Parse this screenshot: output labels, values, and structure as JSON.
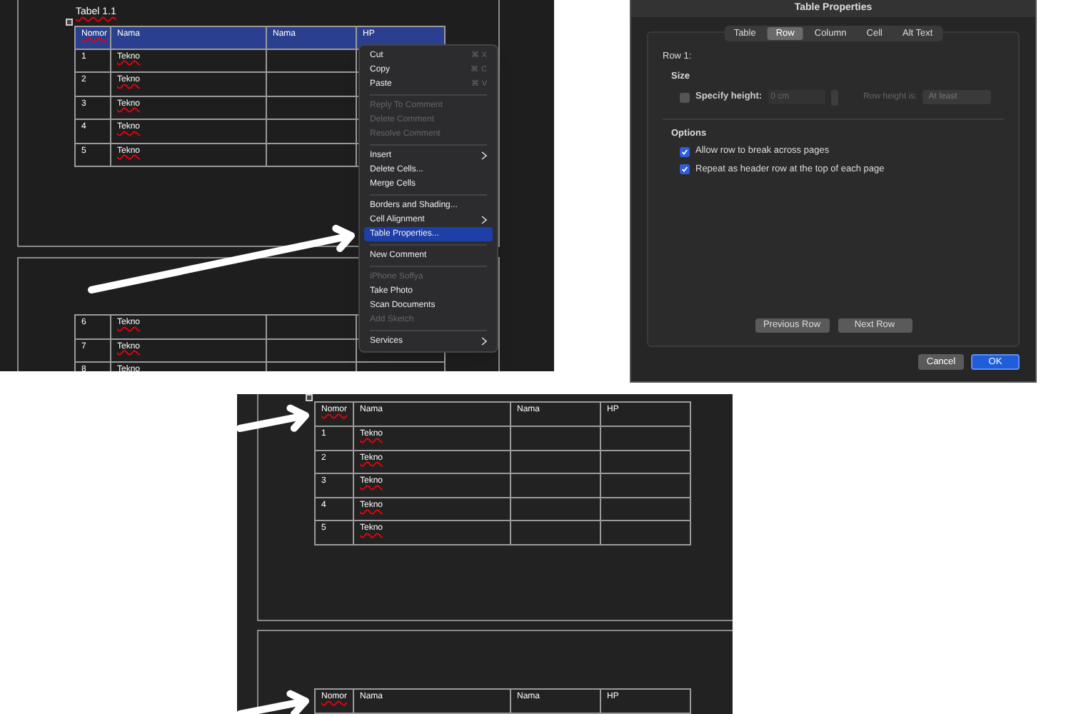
{
  "word_screenshot": {
    "caption": "Tabel 1.1",
    "table": {
      "columns": [
        "Nomor",
        "Nama",
        "Nama",
        "HP"
      ],
      "selected": true,
      "rows": [
        [
          "1",
          "Tekno"
        ],
        [
          "2",
          "Tekno"
        ],
        [
          "3",
          "Tekno"
        ],
        [
          "4",
          "Tekno"
        ],
        [
          "5",
          "Tekno"
        ]
      ]
    },
    "next_page_table": {
      "rows": [
        [
          "6",
          "Tekno"
        ],
        [
          "7",
          "Tekno"
        ],
        [
          "8",
          "Tekno"
        ]
      ]
    },
    "context_menu": [
      {
        "kind": "item",
        "label": "Cut",
        "shortcut": "⌘ X",
        "disabled": false,
        "selected": false,
        "submenu": false
      },
      {
        "kind": "item",
        "label": "Copy",
        "shortcut": "⌘ C",
        "disabled": false,
        "selected": false,
        "submenu": false
      },
      {
        "kind": "item",
        "label": "Paste",
        "shortcut": "⌘ V",
        "disabled": false,
        "selected": false,
        "submenu": false
      },
      {
        "kind": "separator"
      },
      {
        "kind": "item",
        "label": "Reply To Comment",
        "disabled": true,
        "selected": false,
        "submenu": false
      },
      {
        "kind": "item",
        "label": "Delete Comment",
        "disabled": true,
        "selected": false,
        "submenu": false
      },
      {
        "kind": "item",
        "label": "Resolve Comment",
        "disabled": true,
        "selected": false,
        "submenu": false
      },
      {
        "kind": "separator"
      },
      {
        "kind": "item",
        "label": "Insert",
        "disabled": false,
        "selected": false,
        "submenu": true
      },
      {
        "kind": "item",
        "label": "Delete Cells...",
        "disabled": false,
        "selected": false,
        "submenu": false
      },
      {
        "kind": "item",
        "label": "Merge Cells",
        "disabled": false,
        "selected": false,
        "submenu": false
      },
      {
        "kind": "separator"
      },
      {
        "kind": "item",
        "label": "Borders and Shading...",
        "disabled": false,
        "selected": false,
        "submenu": false
      },
      {
        "kind": "item",
        "label": "Cell Alignment",
        "disabled": false,
        "selected": false,
        "submenu": true
      },
      {
        "kind": "item",
        "label": "Table Properties...",
        "disabled": false,
        "selected": true,
        "submenu": false
      },
      {
        "kind": "separator"
      },
      {
        "kind": "item",
        "label": "New Comment",
        "disabled": false,
        "selected": false,
        "submenu": false
      },
      {
        "kind": "separator"
      },
      {
        "kind": "item",
        "label": "iPhone Soffya",
        "disabled": true,
        "selected": false,
        "submenu": false
      },
      {
        "kind": "item",
        "label": "Take Photo",
        "disabled": false,
        "selected": false,
        "submenu": false
      },
      {
        "kind": "item",
        "label": "Scan Documents",
        "disabled": false,
        "selected": false,
        "submenu": false
      },
      {
        "kind": "item",
        "label": "Add Sketch",
        "disabled": true,
        "selected": false,
        "submenu": false
      },
      {
        "kind": "separator"
      },
      {
        "kind": "item",
        "label": "Services",
        "disabled": false,
        "selected": false,
        "submenu": true
      }
    ]
  },
  "dialog": {
    "title": "Table Properties",
    "tabs": [
      {
        "label": "Table",
        "selected": false
      },
      {
        "label": "Row",
        "selected": true
      },
      {
        "label": "Column",
        "selected": false
      },
      {
        "label": "Cell",
        "selected": false
      },
      {
        "label": "Alt Text",
        "selected": false
      }
    ],
    "row_label": "Row 1:",
    "size_heading": "Size",
    "specify_height": {
      "label": "Specify height:",
      "checked": false,
      "placeholder": "0 cm"
    },
    "row_height_is": {
      "label": "Row height is:",
      "value": "At least",
      "disabled": true
    },
    "options_heading": "Options",
    "options": [
      {
        "label": "Allow row to break across pages",
        "checked": true
      },
      {
        "label": "Repeat as header row at the top of each page",
        "checked": true
      }
    ],
    "nav_buttons": [
      "Previous Row",
      "Next Row"
    ],
    "buttons": [
      {
        "label": "Cancel",
        "primary": false
      },
      {
        "label": "OK",
        "primary": true
      }
    ]
  },
  "result_screenshot": {
    "table": {
      "columns": [
        "Nomor",
        "Nama",
        "Nama",
        "HP"
      ],
      "rows": [
        [
          "1",
          "Tekno"
        ],
        [
          "2",
          "Tekno"
        ],
        [
          "3",
          "Tekno"
        ],
        [
          "4",
          "Tekno"
        ],
        [
          "5",
          "Tekno"
        ]
      ]
    },
    "repeated_header": {
      "columns": [
        "Nomor",
        "Nama",
        "Nama",
        "HP"
      ]
    }
  }
}
